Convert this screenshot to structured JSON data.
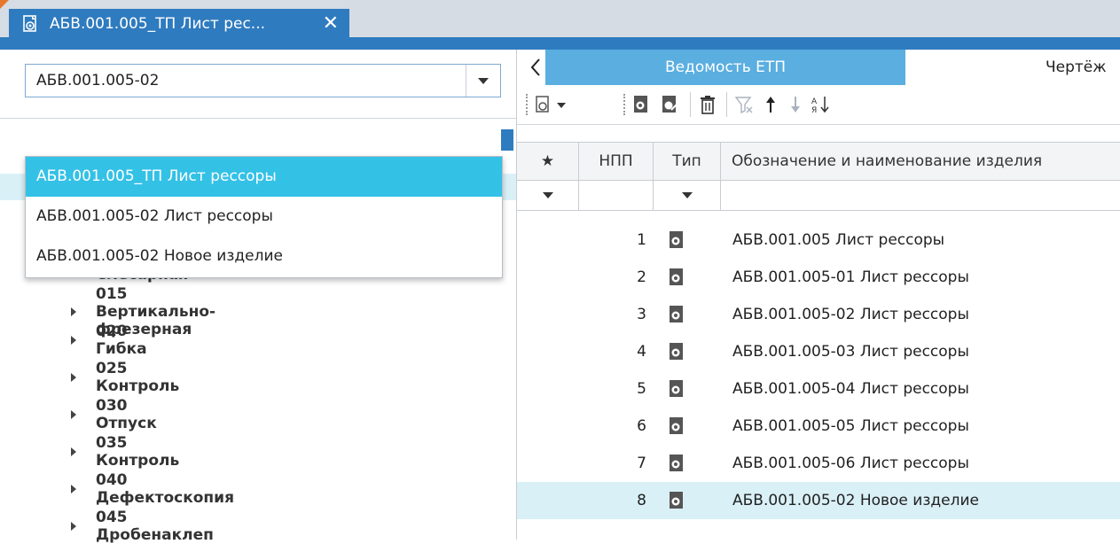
{
  "window": {
    "tab_title": "АБВ.001.005_ТП Лист рес...",
    "tab_close": "✕"
  },
  "left_panel": {
    "combo_value": "АБВ.001.005-02",
    "dropdown_options": [
      {
        "label": "АБВ.001.005_ТП Лист рессоры",
        "selected": true
      },
      {
        "label": "АБВ.001.005-02 Лист рессоры",
        "selected": false
      },
      {
        "label": "АБВ.001.005-02 Новое изделие",
        "selected": false
      }
    ],
    "tree_items": [
      {
        "label": "010 Слесарная"
      },
      {
        "label": "015 Вертикально-фрезерная"
      },
      {
        "label": "020 Гибка"
      },
      {
        "label": "025 Контроль"
      },
      {
        "label": "030 Отпуск"
      },
      {
        "label": "035 Контроль"
      },
      {
        "label": "040 Дефектоскопия"
      },
      {
        "label": "045 Дробенаклеп"
      }
    ]
  },
  "right_panel": {
    "tabs": [
      {
        "label": "Ведомость ЕТП",
        "active": true
      },
      {
        "label": "Чертёж",
        "active": false
      }
    ],
    "toolbar_icons": [
      "add-document-dropdown-icon",
      "document-icon",
      "document-edit-icon",
      "delete-icon",
      "filter-clear-icon",
      "move-up-icon",
      "move-down-icon",
      "sort-az-icon"
    ],
    "grid": {
      "columns": [
        "★",
        "НПП",
        "Тип",
        "Обозначение и наименование изделия"
      ],
      "rows": [
        {
          "npp": "1",
          "name": "АБВ.001.005 Лист рессоры",
          "selected": false
        },
        {
          "npp": "2",
          "name": "АБВ.001.005-01 Лист рессоры",
          "selected": false
        },
        {
          "npp": "3",
          "name": "АБВ.001.005-02 Лист рессоры",
          "selected": false
        },
        {
          "npp": "4",
          "name": "АБВ.001.005-03 Лист рессоры",
          "selected": false
        },
        {
          "npp": "5",
          "name": "АБВ.001.005-04 Лист рессоры",
          "selected": false
        },
        {
          "npp": "6",
          "name": "АБВ.001.005-05 Лист рессоры",
          "selected": false
        },
        {
          "npp": "7",
          "name": "АБВ.001.005-06 Лист рессоры",
          "selected": false
        },
        {
          "npp": "8",
          "name": "АБВ.001.005-02 Новое изделие",
          "selected": true
        }
      ]
    }
  },
  "colors": {
    "accent": "#2f7bbf",
    "tab_active": "#5aaee0",
    "dropdown_selected": "#34c1e6",
    "row_selected": "#d9f0f6"
  }
}
